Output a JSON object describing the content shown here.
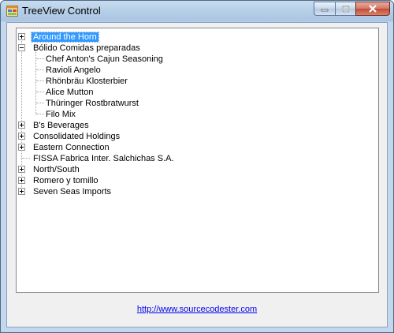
{
  "window": {
    "title": "TreeView Control"
  },
  "caption": {
    "minimize": "minimize",
    "maximize": "maximize",
    "close": "close"
  },
  "tree": {
    "nodes": [
      {
        "label": "Around the Horn",
        "state": "collapsed",
        "selected": true
      },
      {
        "label": "Bólido Comidas preparadas",
        "state": "expanded",
        "children": [
          "Chef Anton's Cajun Seasoning",
          "Ravioli Angelo",
          "Rhönbräu Klosterbier",
          "Alice Mutton",
          "Thüringer Rostbratwurst",
          "Filo Mix"
        ]
      },
      {
        "label": "B's Beverages",
        "state": "collapsed"
      },
      {
        "label": "Consolidated Holdings",
        "state": "collapsed"
      },
      {
        "label": "Eastern Connection",
        "state": "collapsed"
      },
      {
        "label": "FISSA Fabrica Inter. Salchichas S.A.",
        "state": "leaf"
      },
      {
        "label": "North/South",
        "state": "collapsed"
      },
      {
        "label": "Romero y tomillo",
        "state": "collapsed"
      },
      {
        "label": "Seven Seas Imports",
        "state": "collapsed"
      }
    ]
  },
  "footer": {
    "link": "http://www.sourcecodester.com"
  },
  "colors": {
    "selection": "#3399ff",
    "link": "#0000ee"
  }
}
